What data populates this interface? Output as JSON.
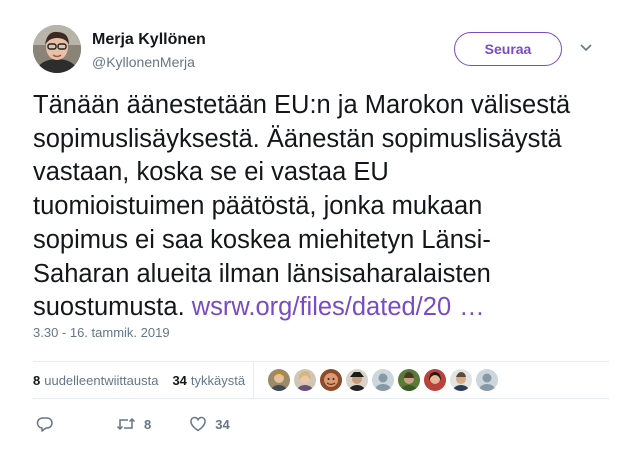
{
  "author": {
    "name": "Merja Kyllönen",
    "handle": "@KyllonenMerja"
  },
  "follow_label": "Seuraa",
  "tweet": {
    "lines": [
      "Tänään äänestetään EU:n ja Marokon välisestä",
      "sopimuslisäyksestä. Äänestän sopimuslisäystä",
      "vastaan, koska se ei vastaa EU",
      "tuomioistuimen päätöstä, jonka mukaan",
      "sopimus ei saa koskea miehitetyn Länsi-",
      "Saharan alueita ilman länsisaharalaisten"
    ],
    "last_line": "suostumusta.",
    "link": "wsrw.org/files/dated/20",
    "link_ellipsis": "…"
  },
  "timestamp": "3.30 - 16. tammik. 2019",
  "stats": {
    "retweets_count": "8",
    "retweets_label": "uudelleentwiittausta",
    "likes_count": "34",
    "likes_label": "tykkäystä"
  },
  "actions": {
    "reply_count": "",
    "retweet_count": "8",
    "like_count": "34"
  },
  "colors": {
    "accent": "#794bc4",
    "text": "#14171a",
    "secondary": "#657786",
    "divider": "#e6ecf0"
  },
  "icons": {
    "caret": "chevron-down-icon",
    "reply": "reply-icon",
    "retweet": "retweet-icon",
    "like": "heart-icon"
  }
}
